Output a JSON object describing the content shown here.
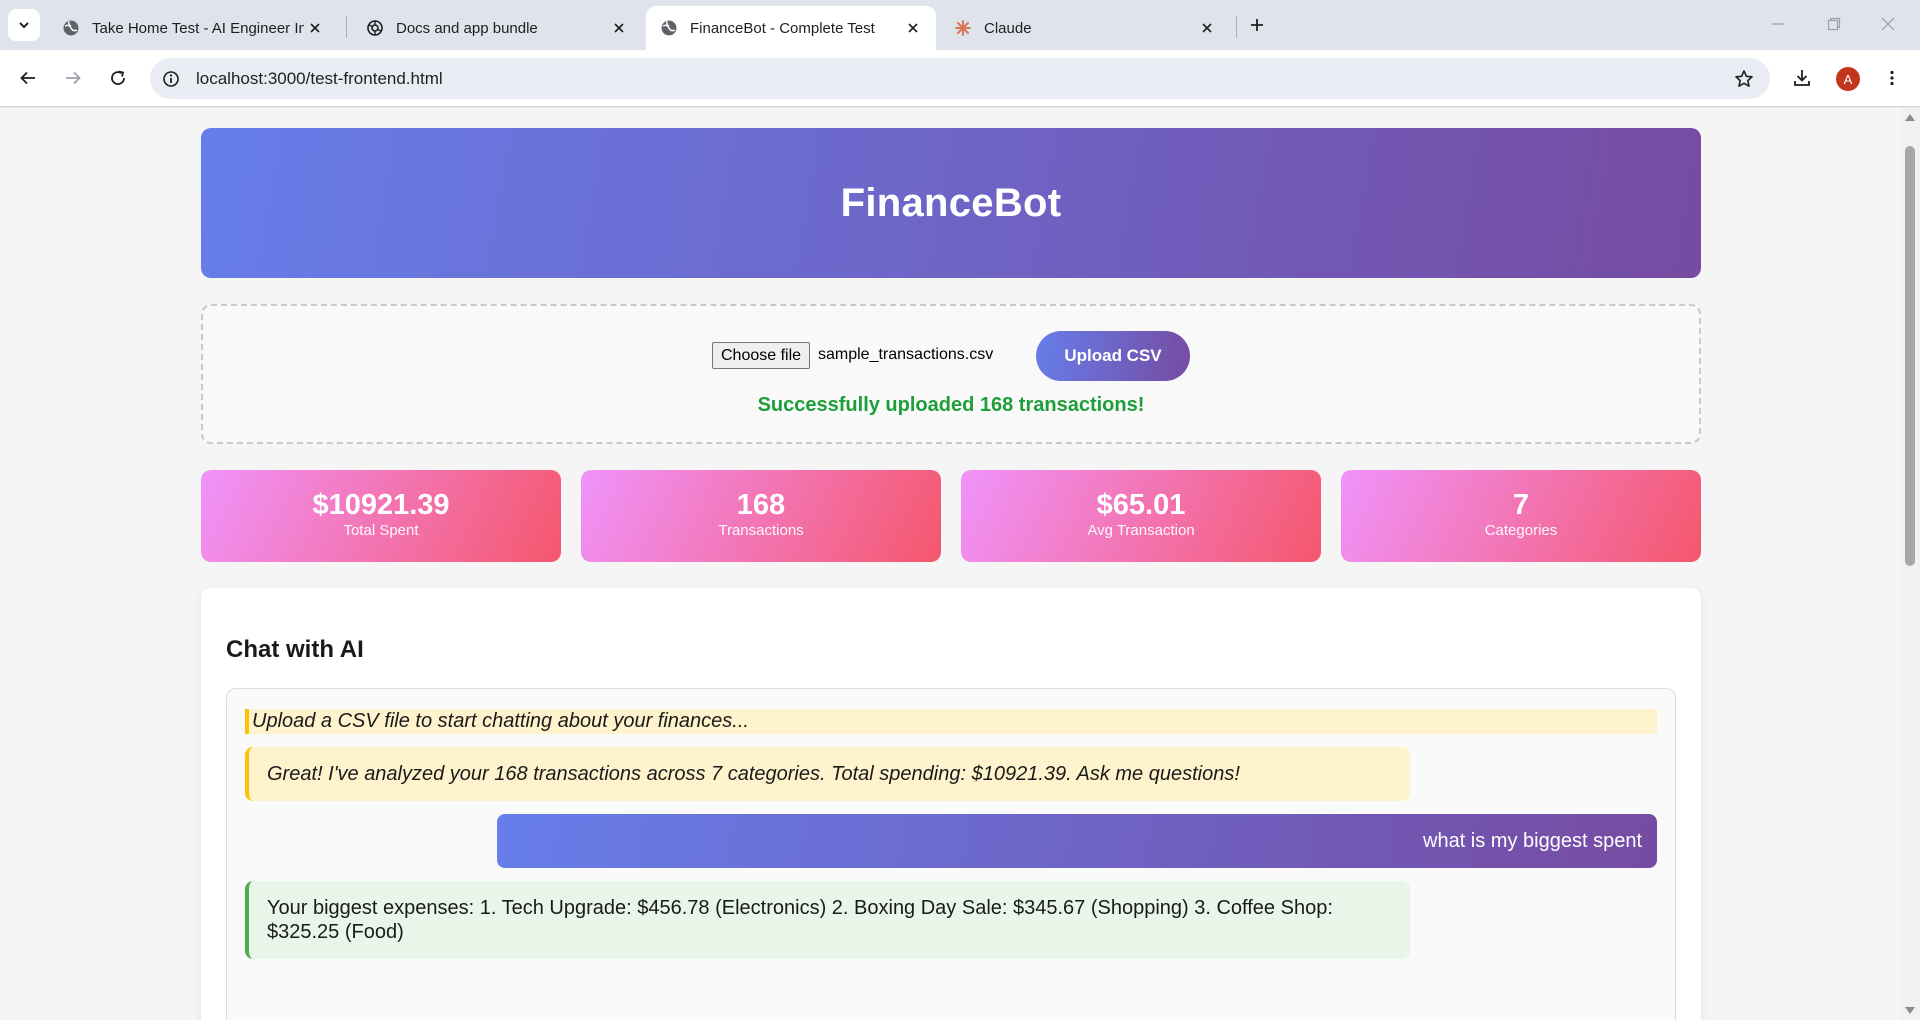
{
  "browser": {
    "tabs": [
      {
        "title": "Take Home Test - AI Engineer In",
        "icon": "globe-icon"
      },
      {
        "title": "Docs and app bundle",
        "icon": "openai-icon"
      },
      {
        "title": "FinanceBot - Complete Test",
        "icon": "globe-icon",
        "active": true
      },
      {
        "title": "Claude",
        "icon": "claude-icon"
      }
    ],
    "url": "localhost:3000/test-frontend.html",
    "profile_initial": "A"
  },
  "page": {
    "title": "FinanceBot",
    "upload": {
      "choose_label": "Choose file",
      "file_name": "sample_transactions.csv",
      "button_label": "Upload CSV",
      "status": "Successfully uploaded 168 transactions!"
    },
    "stats": [
      {
        "value": "$10921.39",
        "label": "Total Spent"
      },
      {
        "value": "168",
        "label": "Transactions"
      },
      {
        "value": "$65.01",
        "label": "Avg Transaction"
      },
      {
        "value": "7",
        "label": "Categories"
      }
    ],
    "chat": {
      "heading": "Chat with AI",
      "messages": [
        {
          "role": "system",
          "text": "Upload a CSV file to start chatting about your finances..."
        },
        {
          "role": "bot-note",
          "text": "Great! I've analyzed your 168 transactions across 7 categories. Total spending: $10921.39. Ask me questions!"
        },
        {
          "role": "user",
          "text": "what is my biggest spent"
        },
        {
          "role": "bot",
          "text": "Your biggest expenses: 1. Tech Upgrade: $456.78 (Electronics) 2. Boxing Day Sale: $345.67 (Shopping) 3. Coffee Shop: $325.25 (Food)"
        }
      ]
    }
  },
  "colors": {
    "header_gradient": [
      "#667eea",
      "#764ba2"
    ],
    "stat_gradient": [
      "#f093fb",
      "#f5576c"
    ],
    "success": "#1e9e3a",
    "system_bg": "#fff3cd",
    "system_border": "#ffc107",
    "bot_bg": "#e8f5e9",
    "bot_border": "#4caf50"
  }
}
